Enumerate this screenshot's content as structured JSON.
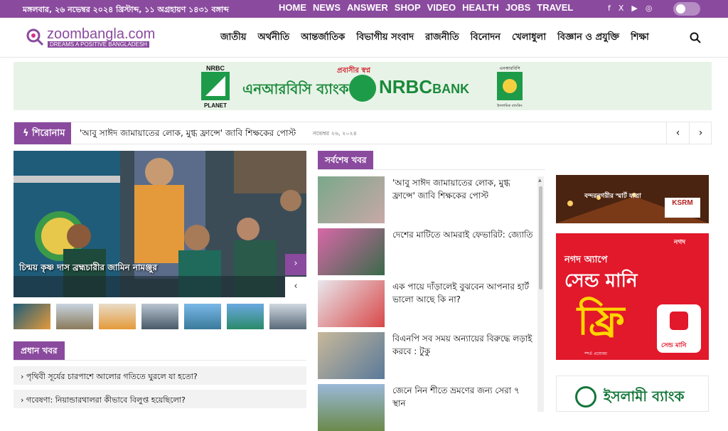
{
  "topbar": {
    "date": "মঙ্গলবার, ২৬ নভেম্বর ২০২৪ খ্রিস্টাব্দ, ১১ অগ্রহায়ণ ১৪৩১ বঙ্গাব্দ",
    "nav": [
      "HOME",
      "NEWS",
      "ANSWER",
      "SHOP",
      "VIDEO",
      "HEALTH",
      "JOBS",
      "TRAVEL"
    ],
    "social": [
      "f",
      "X",
      "▶",
      "◎"
    ]
  },
  "header": {
    "logo_name": "zoombangla.com",
    "logo_tagline": "DREAMS A POSITIVE BANGLADESH",
    "menu": [
      "জাতীয়",
      "অর্থনীতি",
      "আন্তর্জাতিক",
      "বিভাগীয় সংবাদ",
      "রাজনীতি",
      "বিনোদন",
      "খেলাধুলা",
      "বিজ্ঞান ও প্রযুক্তি",
      "শিক্ষা"
    ]
  },
  "banner": {
    "logo_top": "NRBC",
    "logo_bottom": "PLANET",
    "tagline": "প্রবাসীর স্বপ্ন",
    "name_bn": "এনআরবিসি ব্যাংক",
    "name_en": "NRBC",
    "name_en_small": "BANK",
    "islami_top": "এনআরবিসি",
    "islami_bottom": "ইসলামিক ব্যাংকিং"
  },
  "ticker": {
    "label": "শিরোনাম",
    "headline": "'আবু সাঈদ জামায়াতের লোক, মুগ্ধ ফ্রান্সে' জাবি শিক্ষকের পোস্ট",
    "date": "নভেম্বর ২৬, ২০২৪"
  },
  "hero": {
    "caption": "চিন্ময় কৃষ্ণ দাস ব্রহ্মচারীর জামিন নামঞ্জুর"
  },
  "sections": {
    "pradhan": "প্রধান খবর",
    "latest": "সর্বশেষ খবর"
  },
  "pradhan_items": [
    "পৃথিবী সূর্যের চারপাশে আলোর গতিতে ঘুরলে যা হতো?",
    "গবেষণা: নিয়ান্ডারথালরা কীভাবে বিলুপ্ত হয়েছিলো?"
  ],
  "latest_items": [
    "'আবু সাঈদ জামায়াতের লোক, মুগ্ধ ফ্রান্সে' জাবি শিক্ষকের পোস্ট",
    "দেশের মাটিতে আমরাই ফেভারিট: জ্যোতি",
    "এক পায়ে দাঁড়ালেই বুঝবেন আপনার হার্ট ভালো আছে কি না?",
    "বিএনপি সব সময় অন্যায়ের বিরুদ্ধে লড়াই করবে : টুকু",
    "জেনে নিন শীতে ভ্রমণের জন্য সেরা ৭ স্থান"
  ],
  "ads": {
    "ksrm_text": "বন্দরনগরীর স্মার্ট যাত্রা",
    "ksrm_brand": "KSRM",
    "nagad_line1": "নগদ অ্যাপে",
    "nagad_line2": "সেন্ড মানি",
    "nagad_line3": "ফ্রি",
    "nagad_brand": "নগদ",
    "nagad_button": "সেন্ড মানি",
    "nagad_note": "*শর্ত প্রযোজ্য",
    "islami_bank": "ইসলামী ব্যাংক"
  },
  "colors": {
    "brand": "#8a4a9e",
    "banner_bg": "#e8f3e8",
    "nrbc_green": "#1a8a3a",
    "nagad_red": "#e2182b"
  }
}
